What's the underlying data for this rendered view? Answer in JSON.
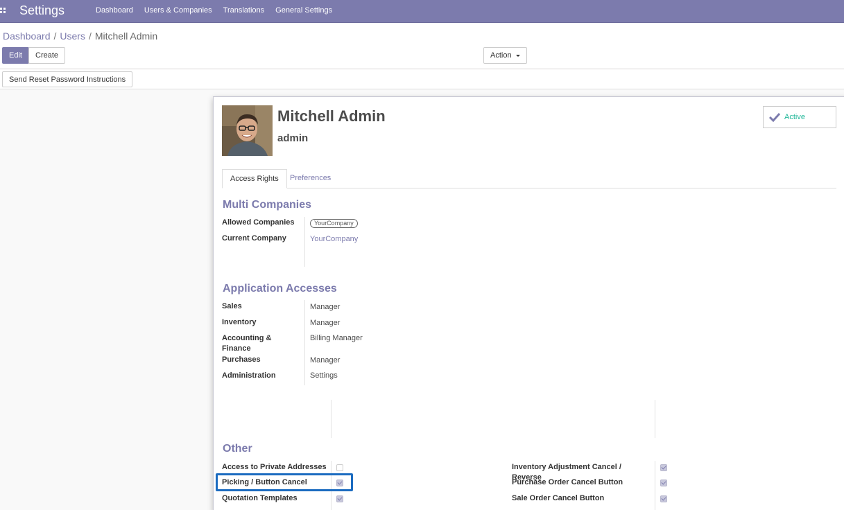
{
  "navbar": {
    "brand": "Settings",
    "menu": [
      "Dashboard",
      "Users & Companies",
      "Translations",
      "General Settings"
    ]
  },
  "breadcrumb": {
    "items": [
      "Dashboard",
      "Users"
    ],
    "current": "Mitchell Admin"
  },
  "buttons": {
    "edit": "Edit",
    "create": "Create",
    "action": "Action",
    "reset_password": "Send Reset Password Instructions"
  },
  "user": {
    "name": "Mitchell Admin",
    "login": "admin",
    "status": "Active"
  },
  "tabs": [
    "Access Rights",
    "Preferences"
  ],
  "multi_companies": {
    "title": "Multi Companies",
    "allowed_label": "Allowed Companies",
    "allowed_tag": "YourCompany",
    "current_label": "Current Company",
    "current_value": "YourCompany"
  },
  "app_accesses": {
    "title": "Application Accesses",
    "rows": [
      {
        "label": "Sales",
        "value": "Manager"
      },
      {
        "label": "Inventory",
        "value": "Manager"
      },
      {
        "label": "Accounting & Finance",
        "value": "Billing Manager"
      },
      {
        "label": "Purchases",
        "value": "Manager"
      },
      {
        "label": "Administration",
        "value": "Settings"
      }
    ]
  },
  "other": {
    "title": "Other",
    "left": [
      {
        "label": "Access to Private Addresses",
        "checked": false
      },
      {
        "label": "Picking / Button Cancel",
        "checked": true
      },
      {
        "label": "Quotation Templates",
        "checked": true
      }
    ],
    "right": [
      {
        "label": "Inventory Adjustment Cancel / Reverse",
        "checked": true
      },
      {
        "label": "Purchase Order Cancel Button",
        "checked": true
      },
      {
        "label": "Sale Order Cancel Button",
        "checked": true
      }
    ]
  },
  "colors": {
    "brand": "#7c7bad",
    "active_status": "#21b799",
    "highlight": "#1b6bc0"
  }
}
